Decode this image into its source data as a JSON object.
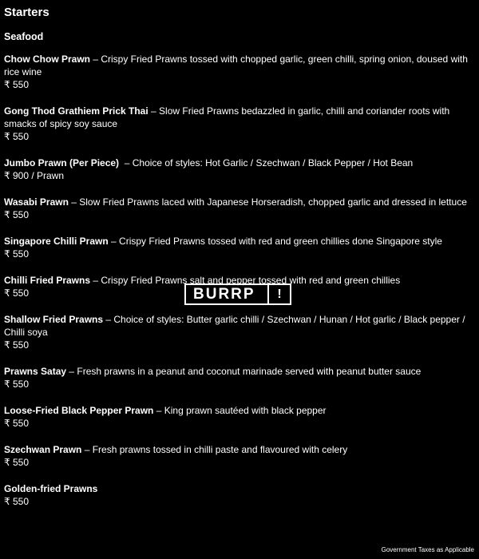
{
  "menu": {
    "title": "Starters",
    "subtitle": "Seafood",
    "items": [
      {
        "name": "Chow Chow Prawn",
        "sep": " – ",
        "desc": "Crispy Fried Prawns tossed with chopped garlic, green chilli, spring onion, doused with rice wine",
        "price": "₹ 550"
      },
      {
        "name": "Gong Thod Grathiem Prick Thai",
        "sep": " – ",
        "desc": "Slow Fried Prawns bedazzled in garlic, chilli and coriander roots with smacks of spicy soy sauce",
        "price": "₹ 550"
      },
      {
        "name": "Jumbo Prawn (Per Piece)",
        "sep": "  – ",
        "desc": "Choice of styles: Hot Garlic / Szechwan / Black Pepper / Hot Bean",
        "price": "₹ 900 / Prawn"
      },
      {
        "name": "Wasabi Prawn",
        "sep": " – ",
        "desc": "Slow Fried Prawns laced with Japanese Horseradish, chopped garlic and dressed in lettuce",
        "price": "₹ 550"
      },
      {
        "name": "Singapore Chilli Prawn",
        "sep": " – ",
        "desc": "Crispy Fried Prawns tossed with red and green chillies done Singapore style",
        "price": "₹ 550"
      },
      {
        "name": "Chilli Fried Prawns",
        "sep": " – ",
        "desc": "Crispy Fried Prawns salt and pepper tossed with red and green chillies",
        "price": "₹ 550"
      },
      {
        "name": "Shallow Fried Prawns",
        "sep": " – ",
        "desc": "Choice of styles: Butter garlic chilli / Szechwan / Hunan / Hot garlic / Black pepper / Chilli soya",
        "price": "₹ 550"
      },
      {
        "name": "Prawns Satay",
        "sep": " – ",
        "desc": "Fresh prawns in a peanut and coconut marinade served with peanut butter sauce",
        "price": "₹ 550"
      },
      {
        "name": "Loose-Fried Black Pepper Prawn",
        "sep": " – ",
        "desc": "King prawn sautéed with black pepper",
        "price": "₹ 550"
      },
      {
        "name": "Szechwan Prawn",
        "sep": " – ",
        "desc": "Fresh prawns tossed in chilli paste and flavoured with celery",
        "price": "₹ 550"
      },
      {
        "name": "Golden-fried Prawns",
        "sep": "",
        "desc": "",
        "price": "₹ 550"
      }
    ]
  },
  "watermark": {
    "text": "BURRP",
    "icon": "!"
  },
  "footer": {
    "note": "Government Taxes as Applicable"
  }
}
